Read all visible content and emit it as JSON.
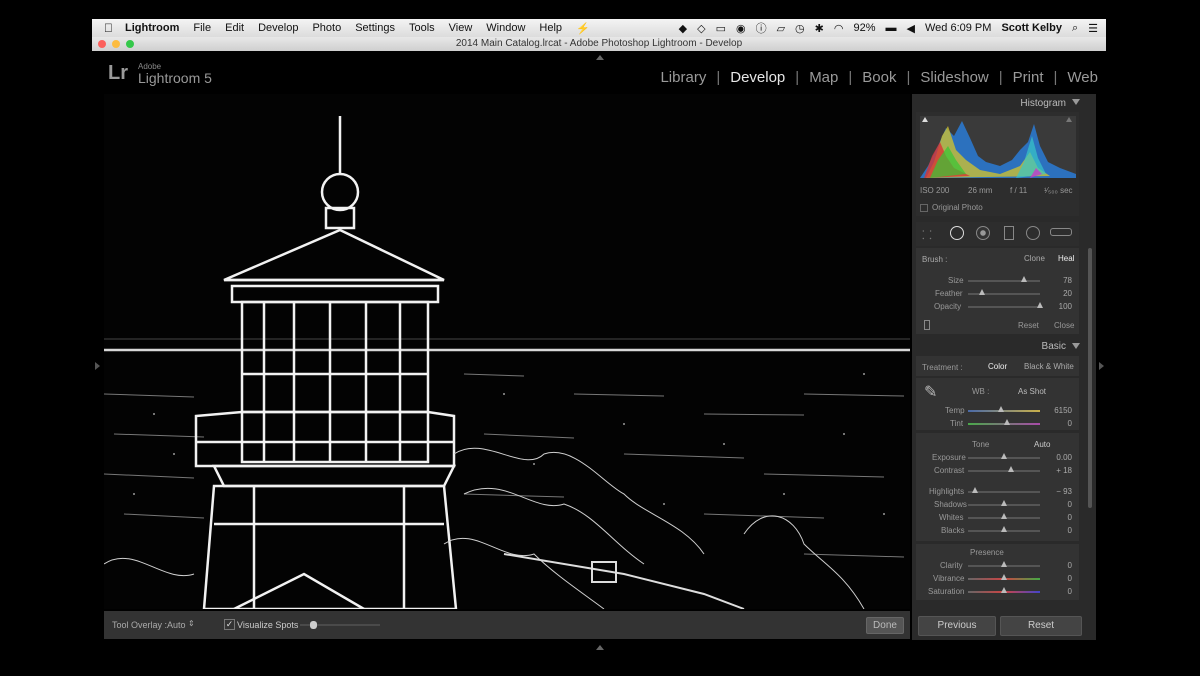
{
  "menubar": {
    "apple": "",
    "app": "Lightroom",
    "items": [
      "File",
      "Edit",
      "Develop",
      "Photo",
      "Settings",
      "Tools",
      "View",
      "Window",
      "Help"
    ],
    "battery": "92%",
    "clock": "Wed 6:09 PM",
    "user": "Scott Kelby"
  },
  "window": {
    "title": "2014 Main Catalog.lrcat - Adobe Photoshop Lightroom - Develop"
  },
  "identity": {
    "mark": "Lr",
    "adobe": "Adobe",
    "product": "Lightroom 5"
  },
  "modules": [
    "Library",
    "Develop",
    "Map",
    "Book",
    "Slideshow",
    "Print",
    "Web"
  ],
  "active_module": "Develop",
  "histogram": {
    "title": "Histogram",
    "iso": "ISO 200",
    "focal": "26 mm",
    "aperture": "f / 11",
    "shutter": "¹⁄₅₀₀ sec",
    "original_photo": "Original Photo"
  },
  "spot_tool": {
    "brush_label": "Brush :",
    "clone": "Clone",
    "heal": "Heal",
    "size_label": "Size",
    "size": "78",
    "feather_label": "Feather",
    "feather": "20",
    "opacity_label": "Opacity",
    "opacity": "100",
    "reset": "Reset",
    "close": "Close",
    "levels": {
      "size": 0.78,
      "feather": 0.2,
      "opacity": 1.0
    }
  },
  "basic": {
    "title": "Basic",
    "treatment_label": "Treatment :",
    "color": "Color",
    "bw": "Black & White",
    "wb_label": "WB :",
    "wb_value": "As Shot",
    "temp_label": "Temp",
    "temp": "6150",
    "tint_label": "Tint",
    "tint": "0",
    "tone_label": "Tone",
    "auto": "Auto",
    "exposure_label": "Exposure",
    "exposure": "0.00",
    "contrast_label": "Contrast",
    "contrast": "+ 18",
    "highlights_label": "Highlights",
    "highlights": "− 93",
    "shadows_label": "Shadows",
    "shadows": "0",
    "whites_label": "Whites",
    "whites": "0",
    "blacks_label": "Blacks",
    "blacks": "0",
    "presence_label": "Presence",
    "clarity_label": "Clarity",
    "clarity": "0",
    "vibrance_label": "Vibrance",
    "vibrance": "0",
    "saturation_label": "Saturation",
    "saturation": "0"
  },
  "bottom_buttons": {
    "previous": "Previous",
    "reset": "Reset"
  },
  "toolbar": {
    "tool_overlay_label": "Tool Overlay :",
    "tool_overlay_value": "Auto",
    "visualize_spots": "Visualize Spots",
    "done": "Done"
  },
  "colors": {
    "accent_text": "#e6e6e6",
    "panel": "#2a2a2a",
    "section": "#333333"
  }
}
